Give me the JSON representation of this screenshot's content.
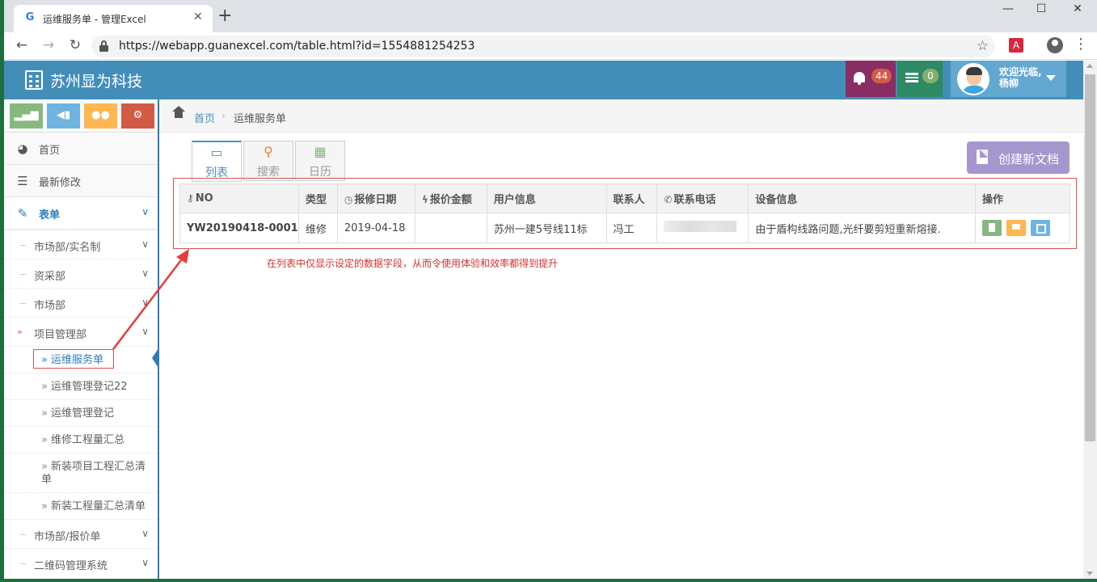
{
  "browser": {
    "tab_title": "运维服务单 - 管理Excel",
    "favicon": "G",
    "url": "https://webapp.guanexcel.com/table.html?id=1554881254253"
  },
  "header": {
    "brand": "苏州显为科技",
    "notifications_count": "44",
    "tasks_count": "0",
    "welcome": "欢迎光临,",
    "username": "杨柳",
    "colors": {
      "bar": "#438eb9",
      "notify": "#892e65",
      "tasks": "#2e8965",
      "user": "#62a8d1"
    }
  },
  "sidebar": {
    "shortcut_colors": [
      "#87b87f",
      "#6fb3e0",
      "#ffb752",
      "#d15b47"
    ],
    "home": "首页",
    "recent": "最新修改",
    "forms": "表单",
    "groups": [
      {
        "label": "市场部/实名制"
      },
      {
        "label": "资采部"
      },
      {
        "label": "市场部"
      },
      {
        "label": "项目管理部"
      }
    ],
    "project_items": [
      {
        "label": "运维服务单"
      },
      {
        "label": "运维管理登记22"
      },
      {
        "label": "运维管理登记"
      },
      {
        "label": "维修工程量汇总"
      },
      {
        "label": "新装项目工程汇总清单"
      },
      {
        "label": "新装工程量汇总清单"
      }
    ],
    "groups_after": [
      {
        "label": "市场部/报价单"
      },
      {
        "label": "二维码管理系统"
      }
    ]
  },
  "breadcrumb": {
    "home": "首页",
    "current": "运维服务单"
  },
  "view_tabs": [
    {
      "label": "列表",
      "icon": "folder-open-icon"
    },
    {
      "label": "搜索",
      "icon": "search-icon"
    },
    {
      "label": "日历",
      "icon": "calendar-icon"
    }
  ],
  "create_button": "创建新文档",
  "table": {
    "columns": [
      "NO",
      "类型",
      "报修日期",
      "报价金额",
      "用户信息",
      "联系人",
      "联系电话",
      "设备信息",
      "操作"
    ],
    "rows": [
      {
        "no": "YW20190418-0001",
        "type": "维修",
        "date": "2019-04-18",
        "amount": "",
        "user_info": "苏州一建5号线11标",
        "contact": "冯工",
        "device": "由于盾构线路问题,光纤要剪短重新熔接."
      }
    ]
  },
  "annotation": "在列表中仅显示设定的数据字段，从而令使用体验和效率都得到提升"
}
